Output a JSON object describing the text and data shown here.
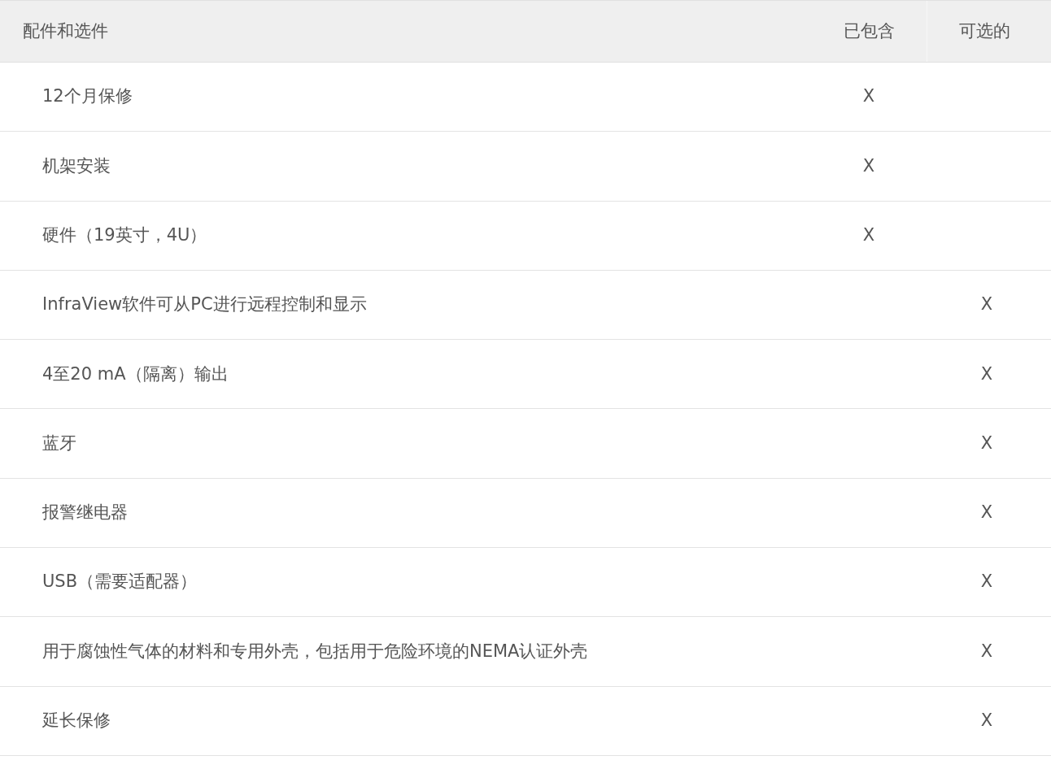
{
  "table": {
    "columns": [
      "配件和选件",
      "已包含",
      "可选的"
    ],
    "rows": [
      {
        "item": "12个月保修",
        "included": "X"
      },
      {
        "item": "机架安装",
        "included": "X"
      },
      {
        "item": "硬件（19英寸，4U）",
        "included": "X"
      },
      {
        "item": "InfraView软件可从PC进行远程控制和显示",
        "optional": "X"
      },
      {
        "item": "4至20 mA（隔离）输出",
        "optional": "X"
      },
      {
        "item": "蓝牙",
        "optional": "X"
      },
      {
        "item": "报警继电器",
        "optional": "X"
      },
      {
        "item": "USB（需要适配器）",
        "optional": "X"
      },
      {
        "item": "用于腐蚀性气体的材料和专用外壳，包括用于危险环境的NEMA认证外壳",
        "optional": "X"
      },
      {
        "item": "延长保修",
        "optional": "X"
      }
    ]
  }
}
